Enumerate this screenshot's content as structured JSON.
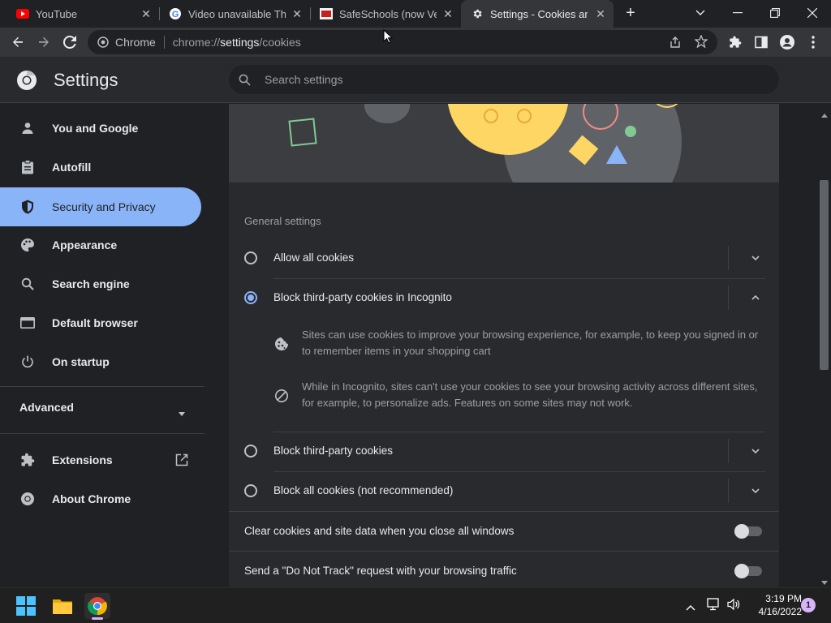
{
  "tabs": [
    {
      "title": "YouTube",
      "close": "✕"
    },
    {
      "title": "Video unavailable This",
      "close": "✕"
    },
    {
      "title": "SafeSchools (now Vect",
      "close": "✕"
    },
    {
      "title": "Settings - Cookies and",
      "close": "✕",
      "active": true
    }
  ],
  "new_tab_label": "+",
  "toolbar": {
    "site_label": "Chrome",
    "url_prefix": "chrome://",
    "url_host": "settings",
    "url_path": "/cookies"
  },
  "settings": {
    "title": "Settings",
    "search_placeholder": "Search settings"
  },
  "sidebar": {
    "items": [
      {
        "label": "You and Google",
        "icon": "person-icon"
      },
      {
        "label": "Autofill",
        "icon": "clipboard-icon"
      },
      {
        "label": "Security and Privacy",
        "icon": "shield-icon",
        "selected": true
      },
      {
        "label": "Appearance",
        "icon": "palette-icon"
      },
      {
        "label": "Search engine",
        "icon": "search-icon"
      },
      {
        "label": "Default browser",
        "icon": "browser-icon"
      },
      {
        "label": "On startup",
        "icon": "power-icon"
      }
    ],
    "advanced_label": "Advanced",
    "extensions_label": "Extensions",
    "about_label": "About Chrome"
  },
  "cookies": {
    "section_title": "General settings",
    "options": [
      {
        "label": "Allow all cookies",
        "selected": false,
        "expanded": false
      },
      {
        "label": "Block third-party cookies in Incognito",
        "selected": true,
        "expanded": true
      },
      {
        "label": "Block third-party cookies",
        "selected": false,
        "expanded": false
      },
      {
        "label": "Block all cookies (not recommended)",
        "selected": false,
        "expanded": false
      }
    ],
    "details": [
      "Sites can use cookies to improve your browsing experience, for example, to keep you signed in or to remember items in your shopping cart",
      "While in Incognito, sites can't use your cookies to see your browsing activity across different sites, for example, to personalize ads. Features on some sites may not work."
    ],
    "toggles": [
      {
        "label": "Clear cookies and site data when you close all windows",
        "on": false
      },
      {
        "label": "Send a \"Do Not Track\" request with your browsing traffic",
        "on": false
      }
    ]
  },
  "taskbar": {
    "time": "3:19 PM",
    "date": "4/16/2022",
    "notification_count": "1"
  },
  "colors": {
    "accent": "#8ab4f8",
    "background": "#202124",
    "card": "#292a2d"
  }
}
